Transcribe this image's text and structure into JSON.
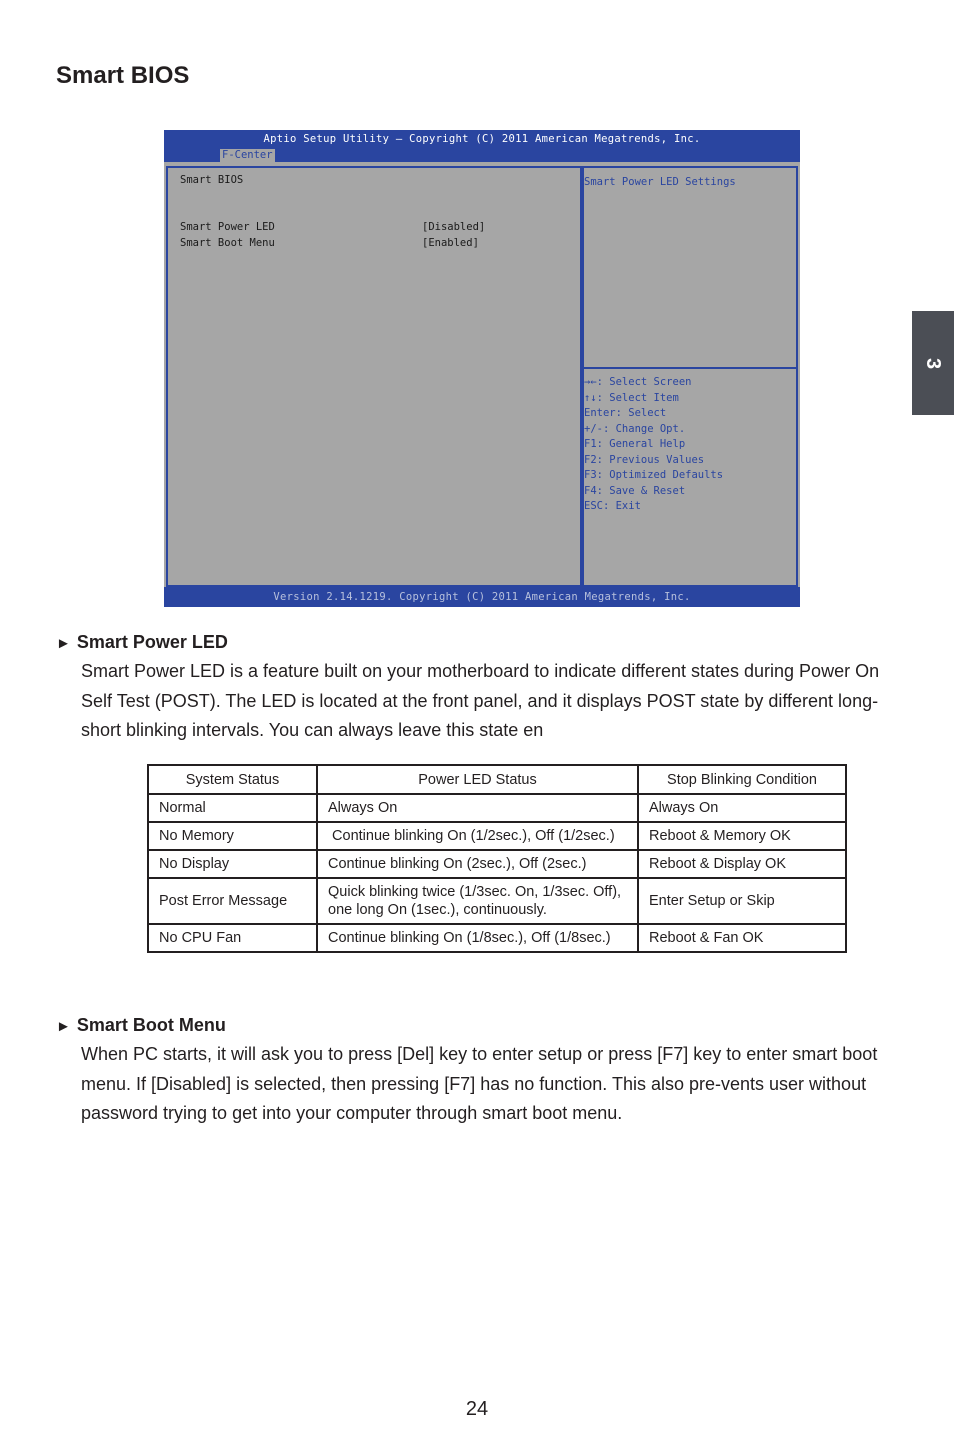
{
  "page": {
    "title": "Smart BIOS",
    "chapter_tab": "3",
    "page_number": "24"
  },
  "bios": {
    "header_title": "Aptio Setup Utility – Copyright (C) 2011 American Megatrends, Inc.",
    "active_tab": "F-Center",
    "main": {
      "section_title": "Smart BIOS",
      "items": [
        {
          "label": "Smart Power LED",
          "value": "[Disabled]"
        },
        {
          "label": "Smart Boot Menu",
          "value": "[Enabled]"
        }
      ]
    },
    "side": {
      "help_title": "Smart Power LED Settings",
      "keys": [
        "→←: Select Screen",
        "↑↓: Select Item",
        "Enter: Select",
        "+/-: Change Opt.",
        "F1: General Help",
        "F2: Previous Values",
        "F3: Optimized Defaults",
        "F4: Save & Reset",
        "ESC: Exit"
      ]
    },
    "footer": "Version 2.14.1219. Copyright (C) 2011 American Megatrends, Inc.",
    "colors": {
      "blue": "#2a45a0",
      "gray": "#a6a6a6"
    }
  },
  "sections": {
    "power_led": {
      "heading": "Smart Power LED",
      "body": "Smart Power LED is a feature built on your motherboard to indicate different states during Power On Self Test (POST). The LED is located at the front panel, and it displays POST state by different long-short blinking intervals. You can always leave this state en"
    },
    "boot_menu": {
      "heading": "Smart Boot Menu",
      "body": "When PC starts, it will ask you to press [Del] key to enter setup or press [F7] key to enter smart boot menu. If [Disabled] is selected, then pressing [F7] has no function. This also pre-vents user without password trying to get into your computer through smart boot menu."
    }
  },
  "table": {
    "headers": [
      "System Status",
      "Power LED Status",
      "Stop Blinking Condition"
    ],
    "rows": [
      [
        "Normal",
        "Always On",
        "Always On"
      ],
      [
        "No Memory",
        " Continue blinking On (1/2sec.), Off (1/2sec.)",
        "Reboot & Memory OK"
      ],
      [
        "No Display",
        "Continue blinking On (2sec.), Off (2sec.)",
        "Reboot & Display OK"
      ],
      [
        "Post Error Message",
        "Quick blinking twice (1/3sec. On, 1/3sec. Off), one long On (1sec.), continuously.",
        "Enter Setup or Skip"
      ],
      [
        "No CPU Fan",
        "Continue blinking On (1/8sec.), Off (1/8sec.)",
        "Reboot & Fan OK"
      ]
    ]
  }
}
